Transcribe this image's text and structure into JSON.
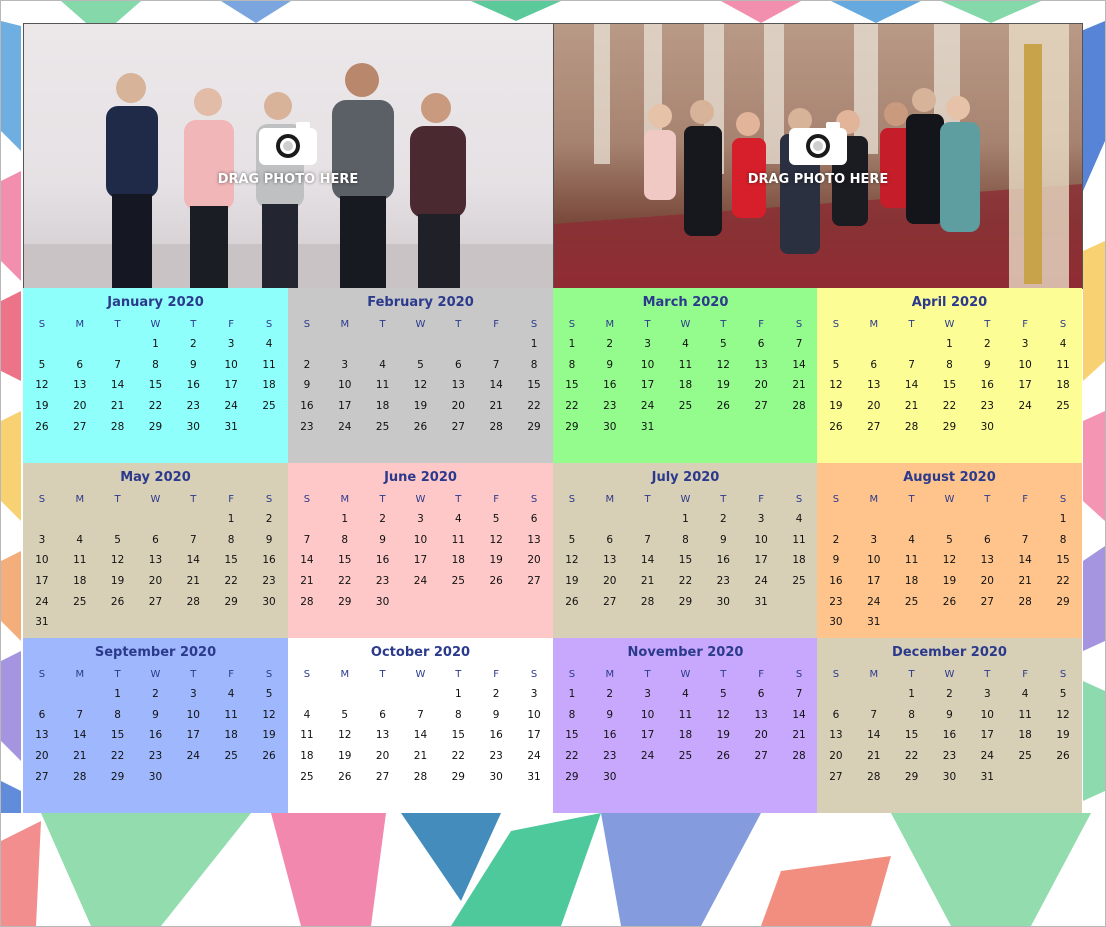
{
  "photo_slots": [
    {
      "label": "DRAG PHOTO HERE",
      "icon": "camera-icon"
    },
    {
      "label": "DRAG PHOTO HERE",
      "icon": "camera-icon"
    }
  ],
  "weekday_headers": [
    "S",
    "M",
    "T",
    "W",
    "T",
    "F",
    "S"
  ],
  "months": [
    {
      "title": "January 2020",
      "color": "#8ffffc",
      "weeks": [
        [
          "",
          "",
          "",
          "1",
          "2",
          "3",
          "4"
        ],
        [
          "5",
          "6",
          "7",
          "8",
          "9",
          "10",
          "11"
        ],
        [
          "12",
          "13",
          "14",
          "15",
          "16",
          "17",
          "18"
        ],
        [
          "19",
          "20",
          "21",
          "22",
          "23",
          "24",
          "25"
        ],
        [
          "26",
          "27",
          "28",
          "29",
          "30",
          "31",
          ""
        ]
      ]
    },
    {
      "title": "February 2020",
      "color": "#c8c8c8",
      "weeks": [
        [
          "",
          "",
          "",
          "",
          "",
          "",
          "1"
        ],
        [
          "2",
          "3",
          "4",
          "5",
          "6",
          "7",
          "8"
        ],
        [
          "9",
          "10",
          "11",
          "12",
          "13",
          "14",
          "15"
        ],
        [
          "16",
          "17",
          "18",
          "19",
          "20",
          "21",
          "22"
        ],
        [
          "23",
          "24",
          "25",
          "26",
          "27",
          "28",
          "29"
        ]
      ]
    },
    {
      "title": "March 2020",
      "color": "#94fc8c",
      "weeks": [
        [
          "1",
          "2",
          "3",
          "4",
          "5",
          "6",
          "7"
        ],
        [
          "8",
          "9",
          "10",
          "11",
          "12",
          "13",
          "14"
        ],
        [
          "15",
          "16",
          "17",
          "18",
          "19",
          "20",
          "21"
        ],
        [
          "22",
          "23",
          "24",
          "25",
          "26",
          "27",
          "28"
        ],
        [
          "29",
          "30",
          "31",
          "",
          "",
          "",
          ""
        ]
      ]
    },
    {
      "title": "April 2020",
      "color": "#fdfd96",
      "weeks": [
        [
          "",
          "",
          "",
          "1",
          "2",
          "3",
          "4"
        ],
        [
          "5",
          "6",
          "7",
          "8",
          "9",
          "10",
          "11"
        ],
        [
          "12",
          "13",
          "14",
          "15",
          "16",
          "17",
          "18"
        ],
        [
          "19",
          "20",
          "21",
          "22",
          "23",
          "24",
          "25"
        ],
        [
          "26",
          "27",
          "28",
          "29",
          "30",
          "",
          ""
        ]
      ]
    },
    {
      "title": "May 2020",
      "color": "#d8cfb7",
      "weeks": [
        [
          "",
          "",
          "",
          "",
          "",
          "1",
          "2"
        ],
        [
          "3",
          "4",
          "5",
          "6",
          "7",
          "8",
          "9"
        ],
        [
          "10",
          "11",
          "12",
          "13",
          "14",
          "15",
          "16"
        ],
        [
          "17",
          "18",
          "19",
          "20",
          "21",
          "22",
          "23"
        ],
        [
          "24",
          "25",
          "26",
          "27",
          "28",
          "29",
          "30"
        ],
        [
          "31",
          "",
          "",
          "",
          "",
          "",
          ""
        ]
      ]
    },
    {
      "title": "June 2020",
      "color": "#fec8c8",
      "weeks": [
        [
          "",
          "1",
          "2",
          "3",
          "4",
          "5",
          "6"
        ],
        [
          "7",
          "8",
          "9",
          "10",
          "11",
          "12",
          "13"
        ],
        [
          "14",
          "15",
          "16",
          "17",
          "18",
          "19",
          "20"
        ],
        [
          "21",
          "22",
          "23",
          "24",
          "25",
          "26",
          "27"
        ],
        [
          "28",
          "29",
          "30",
          "",
          "",
          "",
          ""
        ]
      ]
    },
    {
      "title": "July 2020",
      "color": "#d8cfb7",
      "weeks": [
        [
          "",
          "",
          "",
          "1",
          "2",
          "3",
          "4"
        ],
        [
          "5",
          "6",
          "7",
          "8",
          "9",
          "10",
          "11"
        ],
        [
          "12",
          "13",
          "14",
          "15",
          "16",
          "17",
          "18"
        ],
        [
          "19",
          "20",
          "21",
          "22",
          "23",
          "24",
          "25"
        ],
        [
          "26",
          "27",
          "28",
          "29",
          "30",
          "31",
          ""
        ]
      ]
    },
    {
      "title": "August 2020",
      "color": "#fec48c",
      "weeks": [
        [
          "",
          "",
          "",
          "",
          "",
          "",
          "1"
        ],
        [
          "2",
          "3",
          "4",
          "5",
          "6",
          "7",
          "8"
        ],
        [
          "9",
          "10",
          "11",
          "12",
          "13",
          "14",
          "15"
        ],
        [
          "16",
          "17",
          "18",
          "19",
          "20",
          "21",
          "22"
        ],
        [
          "23",
          "24",
          "25",
          "26",
          "27",
          "28",
          "29"
        ],
        [
          "30",
          "31",
          "",
          "",
          "",
          "",
          ""
        ]
      ]
    },
    {
      "title": "September 2020",
      "color": "#9fb8fd",
      "weeks": [
        [
          "",
          "",
          "1",
          "2",
          "3",
          "4",
          "5"
        ],
        [
          "6",
          "7",
          "8",
          "9",
          "10",
          "11",
          "12"
        ],
        [
          "13",
          "14",
          "15",
          "16",
          "17",
          "18",
          "19"
        ],
        [
          "20",
          "21",
          "22",
          "23",
          "24",
          "25",
          "26"
        ],
        [
          "27",
          "28",
          "29",
          "30",
          "",
          "",
          ""
        ]
      ]
    },
    {
      "title": "October 2020",
      "color": "#ffffff",
      "weeks": [
        [
          "",
          "",
          "",
          "",
          "1",
          "2",
          "3"
        ],
        [
          "4",
          "5",
          "6",
          "7",
          "8",
          "9",
          "10"
        ],
        [
          "11",
          "12",
          "13",
          "14",
          "15",
          "16",
          "17"
        ],
        [
          "18",
          "19",
          "20",
          "21",
          "22",
          "23",
          "24"
        ],
        [
          "25",
          "26",
          "27",
          "28",
          "29",
          "30",
          "31"
        ]
      ]
    },
    {
      "title": "November 2020",
      "color": "#c8a8fd",
      "weeks": [
        [
          "1",
          "2",
          "3",
          "4",
          "5",
          "6",
          "7"
        ],
        [
          "8",
          "9",
          "10",
          "11",
          "12",
          "13",
          "14"
        ],
        [
          "15",
          "16",
          "17",
          "18",
          "19",
          "20",
          "21"
        ],
        [
          "22",
          "23",
          "24",
          "25",
          "26",
          "27",
          "28"
        ],
        [
          "29",
          "30",
          "",
          "",
          "",
          "",
          ""
        ]
      ]
    },
    {
      "title": "December 2020",
      "color": "#d8cfb7",
      "weeks": [
        [
          "",
          "",
          "1",
          "2",
          "3",
          "4",
          "5"
        ],
        [
          "6",
          "7",
          "8",
          "9",
          "10",
          "11",
          "12"
        ],
        [
          "13",
          "14",
          "15",
          "16",
          "17",
          "18",
          "19"
        ],
        [
          "20",
          "21",
          "22",
          "23",
          "24",
          "25",
          "26"
        ],
        [
          "27",
          "28",
          "29",
          "30",
          "31",
          "",
          ""
        ]
      ]
    }
  ]
}
